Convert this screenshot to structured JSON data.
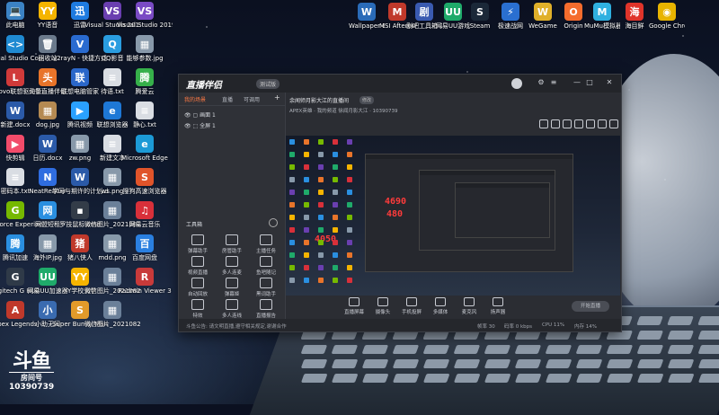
{
  "desktop": {
    "icons": [
      {
        "label": "此电脑",
        "color": "#3b82c4",
        "glyph": "💻"
      },
      {
        "label": "YY语音",
        "color": "#f5b400",
        "glyph": "YY"
      },
      {
        "label": "迅雷",
        "color": "#1e7be0",
        "glyph": "迅"
      },
      {
        "label": "Visual Studio 2015",
        "color": "#6a3fb0",
        "glyph": "VS"
      },
      {
        "label": "Visual Studio 2019",
        "color": "#7a4bc4",
        "glyph": "VS"
      },
      {
        "label": "Visual Studio Code",
        "color": "#1f8ad2",
        "glyph": "<>"
      },
      {
        "label": "回收站",
        "color": "#6b7a8c",
        "glyph": "🗑"
      },
      {
        "label": "v2rayN - 快捷方式",
        "color": "#2a6bd0",
        "glyph": "V"
      },
      {
        "label": "QQ影音",
        "color": "#2a9de0",
        "glyph": "Q"
      },
      {
        "label": "能够参数.jpg",
        "color": "#8899aa",
        "glyph": "▦"
      },
      {
        "label": "Lenovo联想驱动管理",
        "color": "#d03a3a",
        "glyph": "L"
      },
      {
        "label": "头条直播伴侣",
        "color": "#e8742a",
        "glyph": "头"
      },
      {
        "label": "联想电脑管家",
        "color": "#2b67c9",
        "glyph": "联"
      },
      {
        "label": "待语.txt",
        "color": "#d9dde3",
        "glyph": "≡"
      },
      {
        "label": "腾爱云",
        "color": "#36b04a",
        "glyph": "腾"
      },
      {
        "label": "新建.docx",
        "color": "#2b5aa8",
        "glyph": "W"
      },
      {
        "label": "dog.jpg",
        "color": "#b58a52",
        "glyph": "▦"
      },
      {
        "label": "腾讯视频",
        "color": "#2aa1ff",
        "glyph": "▶"
      },
      {
        "label": "联想浏览器",
        "color": "#1e78d6",
        "glyph": "e"
      },
      {
        "label": "静心.txt",
        "color": "#d9dde3",
        "glyph": "≡"
      },
      {
        "label": "快剪辑",
        "color": "#f24b6a",
        "glyph": "▶"
      },
      {
        "label": "日历.docx",
        "color": "#2b5aa8",
        "glyph": "W"
      },
      {
        "label": "zw.png",
        "color": "#8899aa",
        "glyph": "▦"
      },
      {
        "label": "新建文本",
        "color": "#d9dde3",
        "glyph": "≡"
      },
      {
        "label": "Microsoft Edge",
        "color": "#1c9ad6",
        "glyph": "e"
      },
      {
        "label": "密码本.txt",
        "color": "#d9dde3",
        "glyph": "≡"
      },
      {
        "label": "NeatReader",
        "color": "#2f6de0",
        "glyph": "N"
      },
      {
        "label": "学习与期许的计划.docx",
        "color": "#2b5aa8",
        "glyph": "W"
      },
      {
        "label": "ws.png",
        "color": "#8899aa",
        "glyph": "▦"
      },
      {
        "label": "搜狗高速浏览器",
        "color": "#e0542a",
        "glyph": "S"
      },
      {
        "label": "GeForce Experience",
        "color": "#76b900",
        "glyph": "G"
      },
      {
        "label": "网盟短租",
        "color": "#2a8fe0",
        "glyph": "网"
      },
      {
        "label": "罗技鼠标.cmd",
        "color": "#333c48",
        "glyph": "▪"
      },
      {
        "label": "微信图片_2021081...",
        "color": "#6b8099",
        "glyph": "▦"
      },
      {
        "label": "网易云音乐",
        "color": "#d8303a",
        "glyph": "♫"
      },
      {
        "label": "腾讯加速",
        "color": "#2a8fe0",
        "glyph": "腾"
      },
      {
        "label": "海外IP.jpg",
        "color": "#8899aa",
        "glyph": "▦"
      },
      {
        "label": "猪八侠人",
        "color": "#c0392b",
        "glyph": "猪"
      },
      {
        "label": "mdd.png",
        "color": "#8899aa",
        "glyph": "▦"
      },
      {
        "label": "百度网盘",
        "color": "#2a7fe0",
        "glyph": "百"
      },
      {
        "label": "Logitech G HUB",
        "color": "#2f3a48",
        "glyph": "G"
      },
      {
        "label": "网易UU加速器",
        "color": "#1faa6a",
        "glyph": "UU"
      },
      {
        "label": "YY学校大学",
        "color": "#f5b400",
        "glyph": "YY"
      },
      {
        "label": "微信图片_2021082...",
        "color": "#6b8099",
        "glyph": "▦"
      },
      {
        "label": "Radmin Viewer 3",
        "color": "#c83a3a",
        "glyph": "R"
      },
      {
        "label": "Apex Legends",
        "color": "#c0392b",
        "glyph": "A"
      },
      {
        "label": "小助无间",
        "color": "#3a6bb0",
        "glyph": "小"
      },
      {
        "label": "Super Bunny Man",
        "color": "#e29a2a",
        "glyph": "S"
      },
      {
        "label": "微信图片_2021082...",
        "color": "#6b8099",
        "glyph": "▦"
      }
    ],
    "right_icons": [
      {
        "label": "Wallpaper Engine: ...",
        "color": "#2a6bb8",
        "glyph": "W"
      },
      {
        "label": "MSI Afterburner",
        "color": "#c0392b",
        "glyph": "M"
      },
      {
        "label": "剧吧工具箱 2020",
        "color": "#3a5ab0",
        "glyph": "剧"
      },
      {
        "label": "网易UU游戏",
        "color": "#1faa6a",
        "glyph": "UU"
      },
      {
        "label": "Steam",
        "color": "#1b2838",
        "glyph": "S"
      },
      {
        "label": "极速战网",
        "color": "#2a6fd0",
        "glyph": "⚡"
      },
      {
        "label": "WeGame",
        "color": "#e0b02a",
        "glyph": "W"
      },
      {
        "label": "Origin",
        "color": "#f56c2d",
        "glyph": "O"
      },
      {
        "label": "MuMu模拟器",
        "color": "#2fb0e0",
        "glyph": "M"
      },
      {
        "label": "海目鲜",
        "color": "#e0342a",
        "glyph": "海"
      },
      {
        "label": "Google Chrome",
        "color": "#e8b400",
        "glyph": "◉"
      }
    ]
  },
  "douyu": {
    "mark": "斗鱼",
    "sub": "房间号",
    "room": "10390739"
  },
  "window": {
    "brand": "直播伴侣",
    "brand_badge": "测试版",
    "tabs": [
      "我的场景",
      "直播",
      "可调用"
    ],
    "sources": [
      "画面 1",
      "全屏 1"
    ],
    "tools_title": "工具箱",
    "tools": [
      "弹幕助手",
      "房管助手",
      "主播任务",
      "视频直播",
      "多人连麦",
      "鱼吧随记",
      "自动回放",
      "弹幕姬",
      "黑词助手",
      "特效",
      "多人连线",
      "直播报告"
    ],
    "room_title": "余闻师月影大江的直播间",
    "room_badge": "修改",
    "room_sub": "APEX英雄 · 我的频道  徐闻月影大江 · 10390739",
    "controls": [
      "直播屏幕",
      "摄像头",
      "手机投屏",
      "多媒体",
      "麦克风",
      "扬声器"
    ],
    "start_label": "开始直播",
    "status": [
      "斗鱼公告: 请文明直播,遵守相关规定,谢谢合作",
      "帧率 30",
      "码率 0 kbps",
      "CPU 11%",
      "内存 14%"
    ],
    "red_values": [
      "4690",
      "480",
      "4050"
    ]
  }
}
